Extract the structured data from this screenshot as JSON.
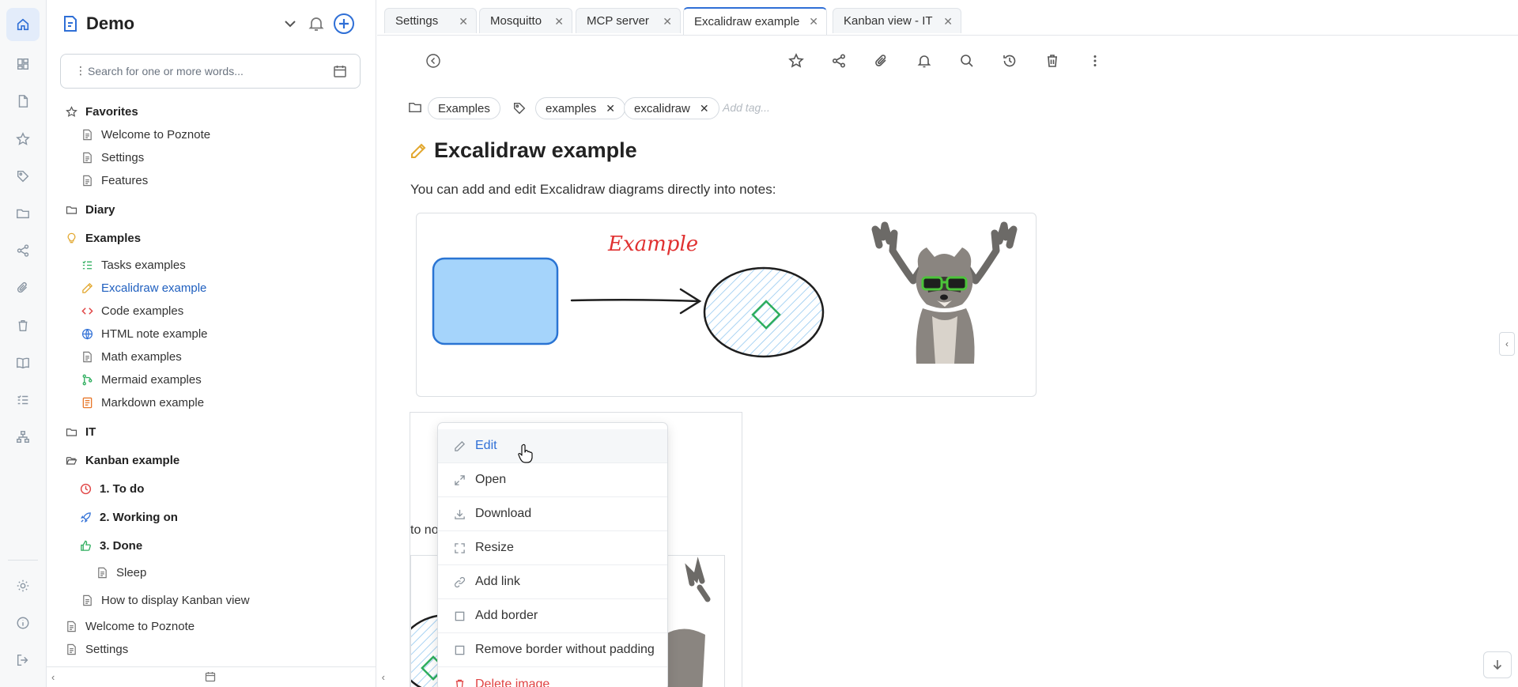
{
  "app": {
    "title": "Demo"
  },
  "search": {
    "placeholder": "Search for one or more words..."
  },
  "tree": {
    "favorites": "Favorites",
    "fav_items": [
      "Welcome to Poznote",
      "Settings",
      "Features"
    ],
    "diary": "Diary",
    "examples": "Examples",
    "example_items": [
      "Tasks examples",
      "Excalidraw example",
      "Code examples",
      "HTML note example",
      "Math examples",
      "Mermaid examples",
      "Markdown example"
    ],
    "it": "IT",
    "kanban": "Kanban example",
    "todo": "1. To do",
    "working": "2. Working on",
    "done": "3. Done",
    "sleep": "Sleep",
    "how_kanban": "How to display Kanban view",
    "welcome": "Welcome to Poznote",
    "settings": "Settings"
  },
  "tabs": [
    {
      "label": "Settings"
    },
    {
      "label": "Mosquitto"
    },
    {
      "label": "MCP server"
    },
    {
      "label": "Excalidraw example"
    },
    {
      "label": "Kanban view - IT"
    }
  ],
  "note": {
    "folder_chip": "Examples",
    "tags": [
      "examples",
      "excalidraw"
    ],
    "add_tag_placeholder": "Add tag...",
    "title": "Excalidraw example",
    "text": "You can add and edit Excalidraw diagrams directly into notes:",
    "diagram_label": "Example",
    "partial_text": "to no"
  },
  "context_menu": [
    "Edit",
    "Open",
    "Download",
    "Resize",
    "Add link",
    "Add border",
    "Remove border without padding",
    "Delete image"
  ],
  "colors": {
    "accent": "#2f6fd6",
    "danger": "#e04444",
    "pencil": "#e2a72e"
  }
}
